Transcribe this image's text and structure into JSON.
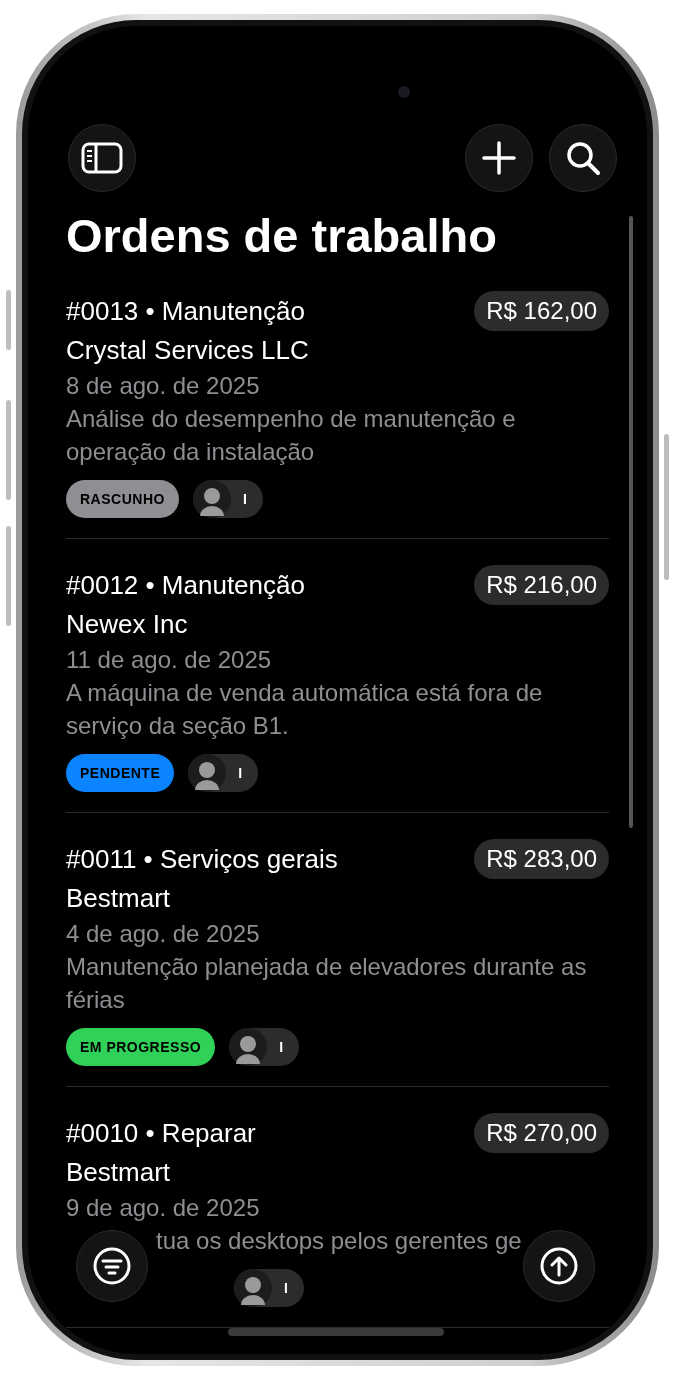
{
  "title": "Ordens de trabalho",
  "orders": [
    {
      "heading": "#0013 • Manutenção",
      "amount": "R$ 162,00",
      "client": "Crystal Services LLC",
      "date": "8 de ago. de 2025",
      "description": "Análise do desempenho de manutenção e operação da instalação",
      "status": {
        "label": "RASCUNHO",
        "color": "#8e8e93"
      },
      "assignee": "I"
    },
    {
      "heading": "#0012 • Manutenção",
      "amount": "R$ 216,00",
      "client": "Newex Inc",
      "date": "11 de ago. de 2025",
      "description": "A máquina de venda automática está fora de serviço da seção B1.",
      "status": {
        "label": "PENDENTE",
        "color": "#0a84ff"
      },
      "assignee": "I"
    },
    {
      "heading": "#0011 • Serviços gerais",
      "amount": "R$ 283,00",
      "client": "Bestmart",
      "date": "4 de ago. de 2025",
      "description": "Manutenção planejada de elevadores durante as férias",
      "status": {
        "label": "EM PROGRESSO",
        "color": "#30d158"
      },
      "assignee": "I"
    },
    {
      "heading": "#0010 • Reparar",
      "amount": "R$ 270,00",
      "client": "Bestmart",
      "date": "9 de ago. de 2025",
      "description": "tua os desktops pelos gerentes ge",
      "description_partial": true,
      "assignee": "I"
    }
  ]
}
